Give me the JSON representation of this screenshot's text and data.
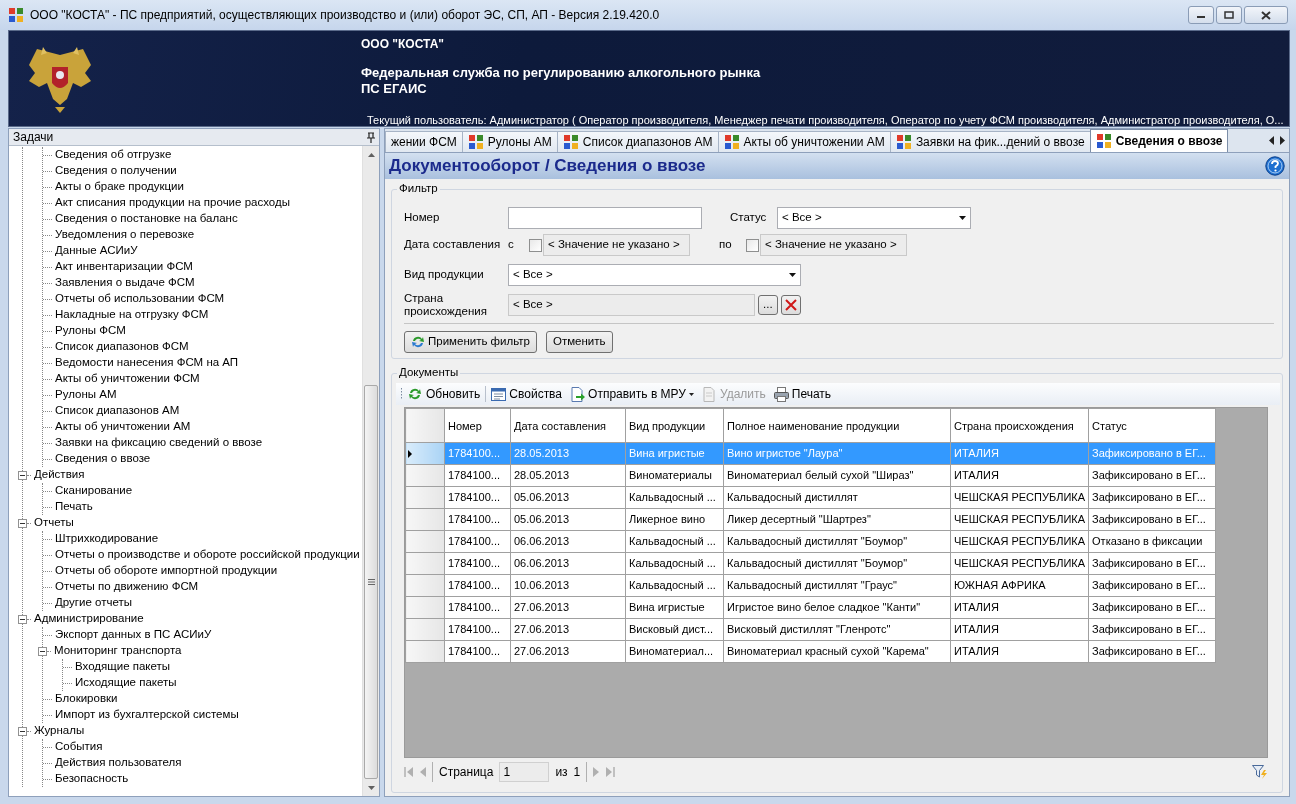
{
  "window": {
    "title": "ООО \"КОСТА\" - ПС предприятий, осуществляющих производство и (или) оборот ЭС, СП, АП - Версия 2.19.420.0"
  },
  "banner": {
    "organization": "ООО \"КОСТА\"",
    "service": "Федеральная служба по регулированию алкогольного рынка",
    "system": "ПС ЕГАИС",
    "current_user": "Текущий пользователь: Администратор ( Оператор производителя, Менеджер печати производителя, Оператор по учету ФСМ производителя, Администратор производителя, О..."
  },
  "tasks_panel": {
    "title": "Задачи",
    "tree": [
      {
        "expanded": true,
        "children": [
          {
            "label": "Сведения об отгрузке"
          },
          {
            "label": "Сведения о получении"
          },
          {
            "label": "Акты о браке продукции"
          },
          {
            "label": "Акт списания продукции на прочие расходы"
          },
          {
            "label": "Сведения о постановке на баланс"
          },
          {
            "label": "Уведомления о перевозке"
          },
          {
            "label": "Данные АСИиУ"
          },
          {
            "label": "Акт инвентаризации ФСМ"
          },
          {
            "label": "Заявления о выдаче ФСМ"
          },
          {
            "label": "Отчеты об использовании ФСМ"
          },
          {
            "label": "Накладные на отгрузку ФСМ"
          },
          {
            "label": "Рулоны ФСМ"
          },
          {
            "label": "Список диапазонов ФСМ"
          },
          {
            "label": "Ведомости нанесения ФСМ на АП"
          },
          {
            "label": "Акты об уничтожении ФСМ"
          },
          {
            "label": "Рулоны АМ"
          },
          {
            "label": "Список диапазонов АМ"
          },
          {
            "label": "Акты об уничтожении АМ"
          },
          {
            "label": "Заявки на фиксацию сведений о ввозе"
          },
          {
            "label": "Сведения о ввозе"
          }
        ]
      },
      {
        "label": "Действия",
        "expanded": true,
        "children": [
          {
            "label": "Сканирование"
          },
          {
            "label": "Печать"
          }
        ]
      },
      {
        "label": "Отчеты",
        "expanded": true,
        "children": [
          {
            "label": "Штрихкодирование"
          },
          {
            "label": "Отчеты о производстве и обороте российской продукции"
          },
          {
            "label": "Отчеты об обороте импортной продукции"
          },
          {
            "label": "Отчеты по движению ФСМ"
          },
          {
            "label": "Другие отчеты"
          }
        ]
      },
      {
        "label": "Администрирование",
        "expanded": true,
        "children": [
          {
            "label": "Экспорт данных в ПС АСИиУ"
          },
          {
            "label": "Мониторинг транспорта",
            "expanded": true,
            "children": [
              {
                "label": "Входящие пакеты"
              },
              {
                "label": "Исходящие пакеты"
              }
            ]
          },
          {
            "label": "Блокировки"
          },
          {
            "label": "Импорт из бухгалтерской системы"
          }
        ]
      },
      {
        "label": "Журналы",
        "expanded": true,
        "children": [
          {
            "label": "События"
          },
          {
            "label": "Действия пользователя"
          },
          {
            "label": "Безопасность"
          }
        ]
      }
    ]
  },
  "tabs": [
    {
      "label": "жении ФСМ",
      "selected": false
    },
    {
      "label": "Рулоны АМ",
      "selected": false
    },
    {
      "label": "Список диапазонов АМ",
      "selected": false
    },
    {
      "label": "Акты об уничтожении АМ",
      "selected": false
    },
    {
      "label": "Заявки на фик...дений о ввозе",
      "selected": false
    },
    {
      "label": "Сведения о ввозе",
      "selected": true
    }
  ],
  "page_title": "Документооборот / Сведения о ввозе",
  "filter": {
    "title": "Фильтр",
    "number": {
      "label": "Номер"
    },
    "status": {
      "label": "Статус",
      "value": "< Все >"
    },
    "date": {
      "label": "Дата составления",
      "from_label": "с",
      "from": {
        "checked": false,
        "value": "< Значение не указано >"
      },
      "to_label": "по",
      "to": {
        "checked": false,
        "value": "< Значение не указано >"
      }
    },
    "product_type": {
      "label": "Вид продукции",
      "value": "< Все >"
    },
    "country": {
      "label": "Страна происхождения",
      "value": "< Все >",
      "browse_button": "..."
    },
    "buttons": [
      "Применить фильтр",
      "Отменить"
    ]
  },
  "documents": {
    "title": "Документы",
    "toolbar": [
      {
        "label": "Обновить",
        "disabled": false,
        "menu": false
      },
      {
        "label": "Свойства",
        "disabled": false,
        "menu": false
      },
      {
        "label": "Отправить в МРУ",
        "disabled": false,
        "menu": true
      },
      {
        "label": "Удалить",
        "disabled": true,
        "menu": false
      },
      {
        "label": "Печать",
        "disabled": false,
        "menu": false
      }
    ],
    "table": {
      "columns": [
        "Номер",
        "Дата составления",
        "Вид продукции",
        "Полное наименование продукции",
        "Страна происхождения",
        "Статус"
      ],
      "rows": [
        {
          "selected": true,
          "cells": [
            "1784100...",
            "28.05.2013",
            "Вина игристые",
            "Вино игристое \"Лаура\"",
            "ИТАЛИЯ",
            "Зафиксировано в ЕГ..."
          ]
        },
        {
          "selected": false,
          "cells": [
            "1784100...",
            "28.05.2013",
            "Виноматериалы",
            "Виноматериал белый сухой \"Шираз\"",
            "ИТАЛИЯ",
            "Зафиксировано в ЕГ..."
          ]
        },
        {
          "selected": false,
          "cells": [
            "1784100...",
            "05.06.2013",
            "Кальвадосный ...",
            "Кальвадосный дистиллят",
            "ЧЕШСКАЯ РЕСПУБЛИКА",
            "Зафиксировано в ЕГ..."
          ]
        },
        {
          "selected": false,
          "cells": [
            "1784100...",
            "05.06.2013",
            "Ликерное вино",
            "Ликер десертный \"Шартрез\"",
            "ЧЕШСКАЯ РЕСПУБЛИКА",
            "Зафиксировано в ЕГ..."
          ]
        },
        {
          "selected": false,
          "cells": [
            "1784100...",
            "06.06.2013",
            "Кальвадосный ...",
            "Кальвадосный дистиллят \"Боумор\"",
            "ЧЕШСКАЯ РЕСПУБЛИКА",
            "Отказано в фиксации"
          ]
        },
        {
          "selected": false,
          "cells": [
            "1784100...",
            "06.06.2013",
            "Кальвадосный ...",
            "Кальвадосный дистиллят \"Боумор\"",
            "ЧЕШСКАЯ РЕСПУБЛИКА",
            "Зафиксировано в ЕГ..."
          ]
        },
        {
          "selected": false,
          "cells": [
            "1784100...",
            "10.06.2013",
            "Кальвадосный ...",
            "Кальвадосный дистиллят \"Граус\"",
            "ЮЖНАЯ АФРИКА",
            "Зафиксировано в ЕГ..."
          ]
        },
        {
          "selected": false,
          "cells": [
            "1784100...",
            "27.06.2013",
            "Вина игристые",
            "Игристое вино белое сладкое \"Канти\"",
            "ИТАЛИЯ",
            "Зафиксировано в ЕГ..."
          ]
        },
        {
          "selected": false,
          "cells": [
            "1784100...",
            "27.06.2013",
            "Висковый дист...",
            "Висковый дистиллят \"Гленротс\"",
            "ИТАЛИЯ",
            "Зафиксировано в ЕГ..."
          ]
        },
        {
          "selected": false,
          "cells": [
            "1784100...",
            "27.06.2013",
            "Виноматериал...",
            "Виноматериал красный сухой \"Карема\"",
            "ИТАЛИЯ",
            "Зафиксировано в ЕГ..."
          ]
        }
      ]
    },
    "pager": {
      "page_label": "Страница",
      "page": "1",
      "of_label": "из",
      "total": "1"
    }
  }
}
